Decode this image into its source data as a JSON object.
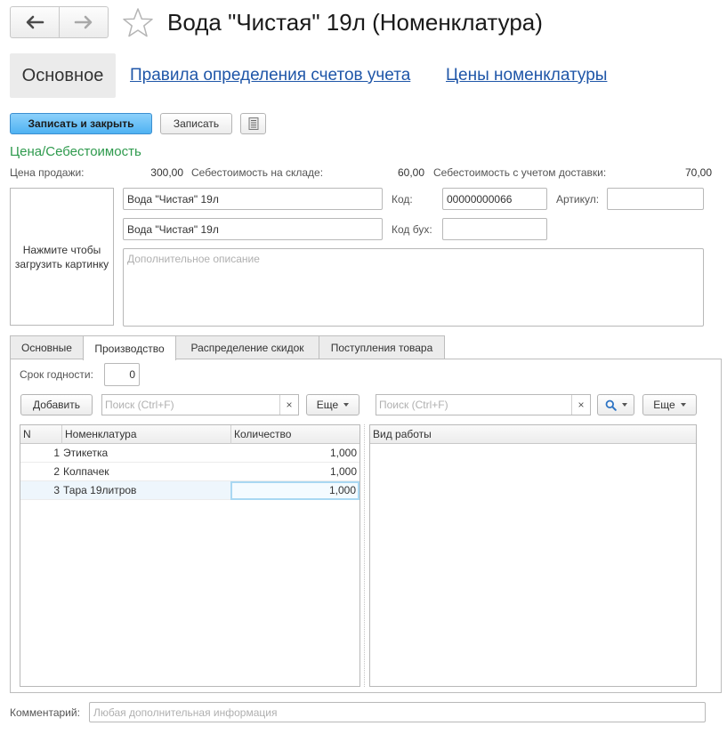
{
  "window": {
    "title": "Вода \"Чистая\" 19л (Номенклатура)",
    "icons": {
      "back": "arrow-left-icon",
      "forward": "arrow-right-icon",
      "favorite": "star-icon"
    }
  },
  "section_nav": {
    "items": [
      {
        "label": "Основное",
        "active": true
      },
      {
        "label": "Правила определения счетов учета",
        "active": false
      },
      {
        "label": "Цены номенклатуры",
        "active": false
      }
    ]
  },
  "toolbar": {
    "save_close_label": "Записать и закрыть",
    "save_label": "Записать",
    "report_icon": "document-list-icon"
  },
  "price_section": {
    "title": "Цена/Себестоимость",
    "sale_price_label": "Цена продажи:",
    "sale_price_value": "300,00",
    "warehouse_cost_label": "Себестоимость на складе:",
    "warehouse_cost_value": "60,00",
    "delivery_cost_label": "Себестоимость с учетом доставки:",
    "delivery_cost_value": "70,00"
  },
  "item": {
    "picture_placeholder": "Нажмите чтобы загрузить картинку",
    "name": "Вода \"Чистая\" 19л",
    "full_name": "Вода \"Чистая\" 19л",
    "code_label": "Код:",
    "code_value": "00000000066",
    "article_label": "Артикул:",
    "article_value": "",
    "acc_code_label": "Код бух:",
    "acc_code_value": "",
    "description_placeholder": "Дополнительное описание"
  },
  "tabs": [
    {
      "label": "Основные",
      "active": false
    },
    {
      "label": "Производство",
      "active": true
    },
    {
      "label": "Распределение скидок",
      "active": false
    },
    {
      "label": "Поступления товара",
      "active": false
    }
  ],
  "production": {
    "shelf_life_label": "Срок годности:",
    "shelf_life_value": "0",
    "left_toolbar": {
      "add_label": "Добавить",
      "search_placeholder": "Поиск (Ctrl+F)",
      "clear_glyph": "×",
      "more_label": "Еще"
    },
    "right_toolbar": {
      "search_placeholder": "Поиск (Ctrl+F)",
      "clear_glyph": "×",
      "more_label": "Еще"
    },
    "components_table": {
      "columns": [
        "N",
        "Номенклатура",
        "Количество"
      ],
      "rows": [
        {
          "n": "1",
          "name": "Этикетка",
          "qty": "1,000"
        },
        {
          "n": "2",
          "name": "Колпачек",
          "qty": "1,000"
        },
        {
          "n": "3",
          "name": "Тара 19литров",
          "qty": "1,000"
        }
      ],
      "selected_row": 3
    },
    "work_table": {
      "columns": [
        "Вид работы"
      ]
    }
  },
  "footer": {
    "comment_label": "Комментарий:",
    "comment_placeholder": "Любая дополнительная информация"
  },
  "colors": {
    "accent_link": "#1f56a8",
    "section_title_green": "#2e9a4d",
    "primary_button": "#4fb2f2",
    "selected_row": "#eef6fc"
  }
}
